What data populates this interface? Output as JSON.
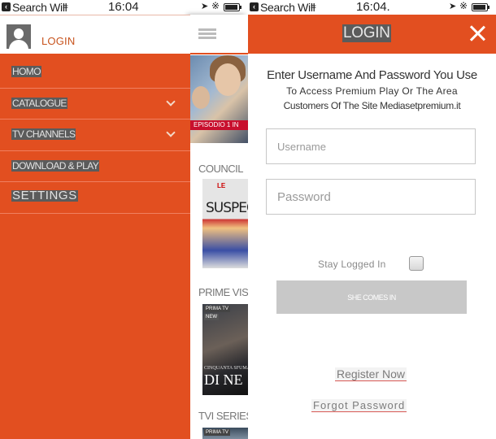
{
  "status_bar": {
    "back_app": "Search Will",
    "time_left": "16:04",
    "time_right": "16:04.",
    "icons": [
      "back-arrow-icon",
      "wifi-icon",
      "location-arrow-icon",
      "bluetooth-icon",
      "battery-icon"
    ]
  },
  "drawer": {
    "login_label": "LOGIN",
    "avatar_icon": "user-silhouette-icon",
    "menu_items": [
      {
        "label": "HOMO",
        "has_submenu": false
      },
      {
        "label": "CATALOGUE",
        "has_submenu": true
      },
      {
        "label": "TV CHANNELS",
        "has_submenu": true
      },
      {
        "label": "DOWNLOAD & PLAY",
        "has_submenu": false
      },
      {
        "label": "SETTINGS",
        "has_submenu": false
      }
    ],
    "accent_color": "#e24f20"
  },
  "content": {
    "menu_icon": "hamburger-icon",
    "hero_ribbon": "EPISODIO 1 IN",
    "sections": [
      {
        "label": "COUNCIL",
        "poster_title": "SUSPECT",
        "poster_top": "LE"
      },
      {
        "label": "PRIME VIS",
        "poster_badge": "PRIMA TV",
        "poster_badge2": "NEW",
        "poster_subtitle": "CINQUANTA SFUMA",
        "poster_title": "DI NE"
      },
      {
        "label": "TVI SERIES",
        "poster_badge": "PRIMA TV"
      }
    ]
  },
  "login": {
    "title": "LOGIN",
    "close_icon": "close-x-icon",
    "intro_line1": "Enter Username And Password You Use",
    "intro_line2": "To Access Premium Play Or The Area",
    "intro_line3": "Customers Of The Site Mediasetpremium.it",
    "username_placeholder": "Username",
    "username_value": "",
    "password_placeholder": "Password",
    "password_value": "",
    "stay_logged_in_label": "Stay Logged In",
    "stay_logged_in_checked": false,
    "submit_label": "SHE COMES IN",
    "register_link": "Register Now",
    "forgot_link": "Forgot Password",
    "header_color": "#e24f20",
    "button_color": "#c8c8c8"
  }
}
